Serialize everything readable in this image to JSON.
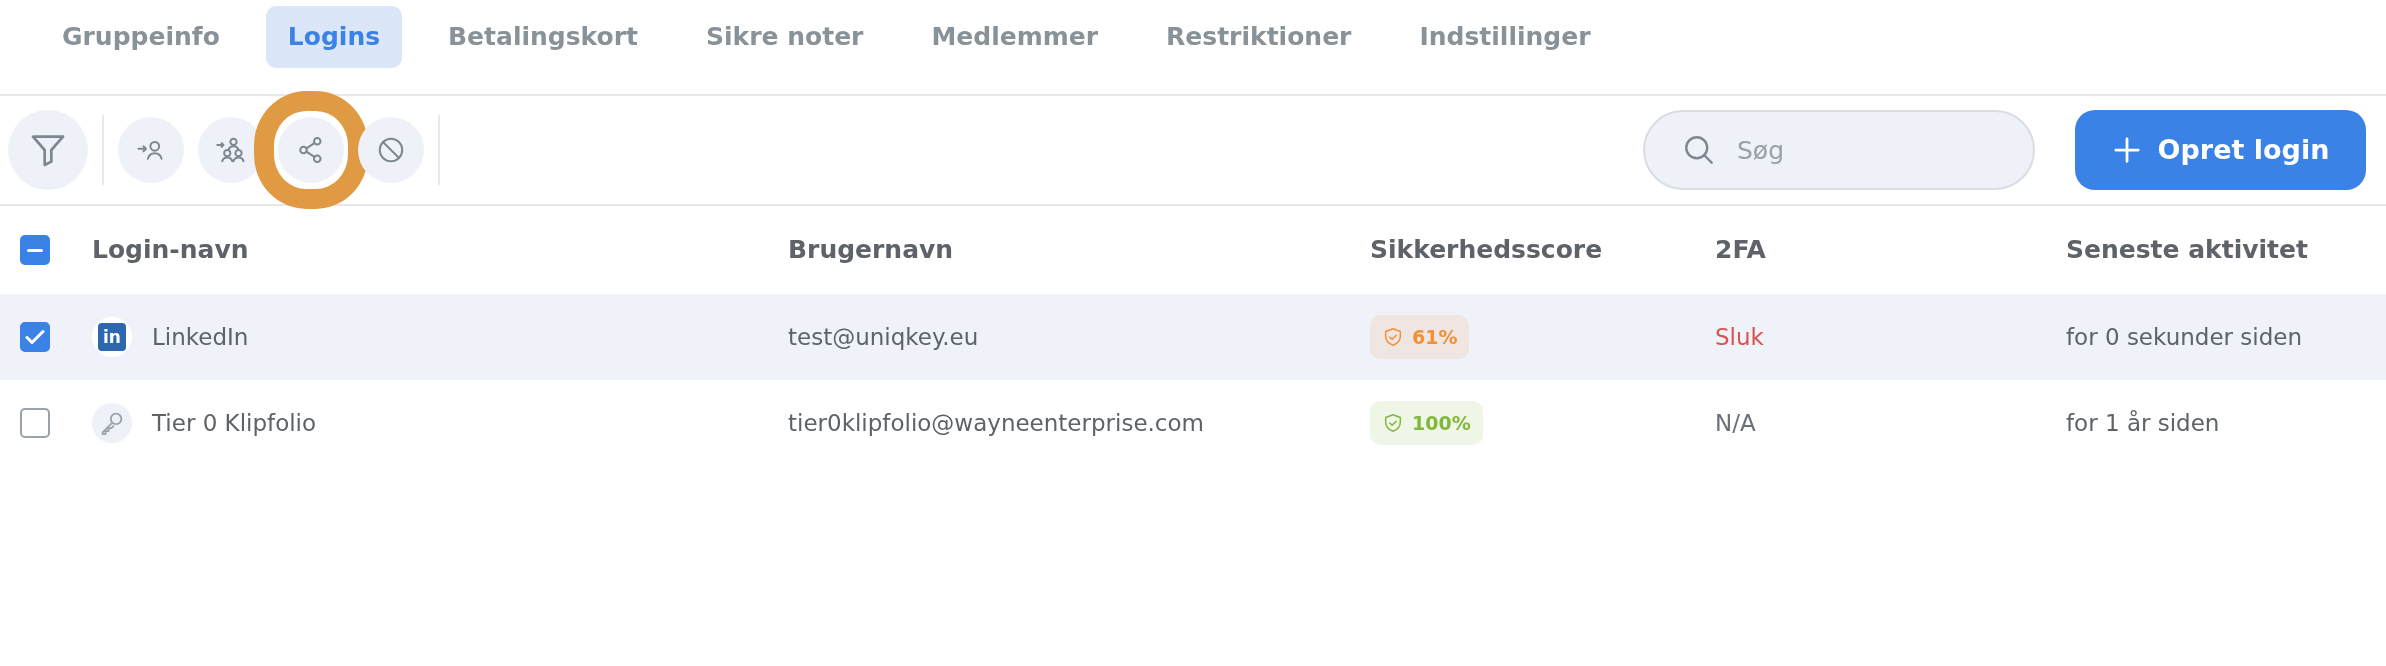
{
  "tabs": [
    {
      "label": "Gruppeinfo",
      "selected": false
    },
    {
      "label": "Logins",
      "selected": true
    },
    {
      "label": "Betalingskort",
      "selected": false
    },
    {
      "label": "Sikre noter",
      "selected": false
    },
    {
      "label": "Medlemmer",
      "selected": false
    },
    {
      "label": "Restriktioner",
      "selected": false
    },
    {
      "label": "Indstillinger",
      "selected": false
    }
  ],
  "toolbar": {
    "filter_button": {
      "highlighted": false
    },
    "action_buttons": [
      {
        "kind": "assign-user",
        "highlighted": false
      },
      {
        "kind": "assign-group",
        "highlighted": false
      },
      {
        "kind": "share",
        "highlighted": true
      },
      {
        "kind": "block",
        "highlighted": false
      }
    ],
    "search": {
      "placeholder": "Søg"
    },
    "create_button": {
      "label": "Opret login"
    }
  },
  "table": {
    "select_all": {
      "indeterminate": true
    },
    "columns": [
      "Login-navn",
      "Brugernavn",
      "Sikkerhedsscore",
      "2FA",
      "Seneste aktivitet"
    ],
    "rows": [
      {
        "selected": true,
        "icon": {
          "kind": "logo",
          "text": "in"
        },
        "name": "LinkedIn",
        "username": "test@uniqkey.eu",
        "score": {
          "text": "61%",
          "color": "#f0913a"
        },
        "twofa": {
          "text": "Sluk",
          "kind": "off"
        },
        "activity": "for 0 sekunder siden"
      },
      {
        "selected": false,
        "icon": {
          "kind": "key"
        },
        "name": "Tier 0 Klipfolio",
        "username": "tier0klipfolio@wayneenterprise.com",
        "score": {
          "text": "100%",
          "color": "#7fb83a"
        },
        "twofa": {
          "text": "N/A",
          "kind": "na"
        },
        "activity": "for 1 år siden"
      }
    ]
  }
}
